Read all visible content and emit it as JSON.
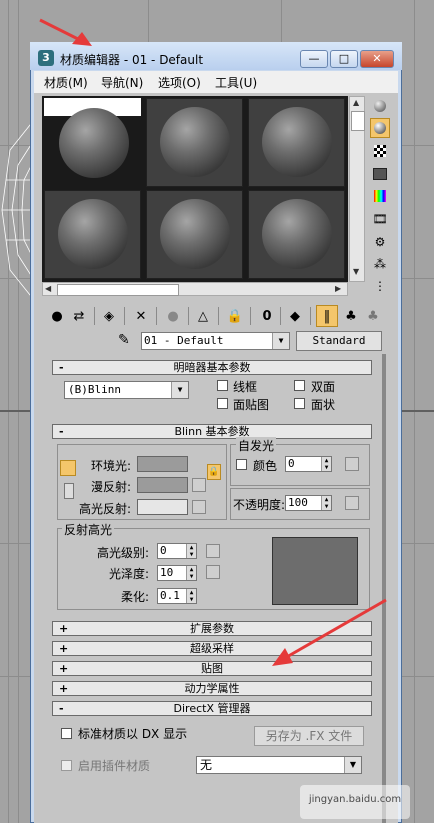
{
  "window": {
    "title": "材质编辑器 - 01 - Default",
    "app_icon": "3",
    "minimize": "—",
    "maximize": "□",
    "close": "✕"
  },
  "menu": [
    "材质(M)",
    "导航(N)",
    "选项(O)",
    "工具(U)"
  ],
  "material_name": "01 - Default",
  "material_type": "Standard",
  "shader_basic": {
    "title": "明暗器基本参数",
    "shader": "(B)Blinn",
    "wire": "线框",
    "two_sided": "双面",
    "face_map": "面贴图",
    "faceted": "面状"
  },
  "blinn_basic": {
    "title": "Blinn 基本参数",
    "ambient": "环境光:",
    "diffuse": "漫反射:",
    "specular": "高光反射:",
    "lock_icon": "lock-icon",
    "self_illum_title": "自发光",
    "color_label": "颜色",
    "self_illum_value": "0",
    "opacity_label": "不透明度:",
    "opacity_value": "100",
    "spec_hl_title": "反射高光",
    "spec_level_label": "高光级别:",
    "spec_level_value": "0",
    "gloss_label": "光泽度:",
    "gloss_value": "10",
    "soften_label": "柔化:",
    "soften_value": "0.1"
  },
  "rollouts": [
    {
      "sign": "+",
      "title": "扩展参数"
    },
    {
      "sign": "+",
      "title": "超级采样"
    },
    {
      "sign": "+",
      "title": "贴图"
    },
    {
      "sign": "+",
      "title": "动力学属性"
    },
    {
      "sign": "-",
      "title": "DirectX 管理器"
    }
  ],
  "directx": {
    "std_material_dx": "标准材质以 DX 显示",
    "save_fx": "另存为 .FX 文件",
    "enable_plugin": "启用插件材质",
    "plugin_value": "无"
  },
  "watermark": "jingyan.baidu.com",
  "colors": {
    "accent": "#f4c66b",
    "annotation_arrow": "#e53a3a",
    "slot_bg": "#404040"
  }
}
